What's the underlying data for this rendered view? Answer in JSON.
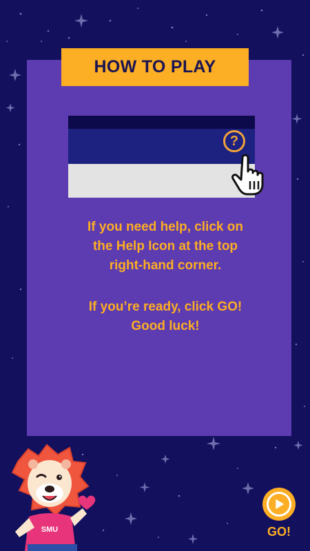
{
  "title": "HOW TO PLAY",
  "demo": {
    "help_icon_glyph": "?",
    "cursor_icon": "hand-pointer-icon"
  },
  "instructions": {
    "line1": "If you need help, click on",
    "line2": "the Help Icon at the top",
    "line3": "right-hand corner.",
    "line4": "If you’re ready, click GO!",
    "line5": "Good luck!"
  },
  "mascot": {
    "shirt_text": "SMU",
    "icon": "lion-mascot-icon"
  },
  "go_button": {
    "label": "GO!",
    "icon": "play-icon"
  },
  "colors": {
    "background": "#13105e",
    "panel": "#5d3bb0",
    "accent": "#fcae24",
    "title_text": "#1b1452",
    "demo_header": "#1d2280",
    "demo_body": "#e3e3e3"
  }
}
